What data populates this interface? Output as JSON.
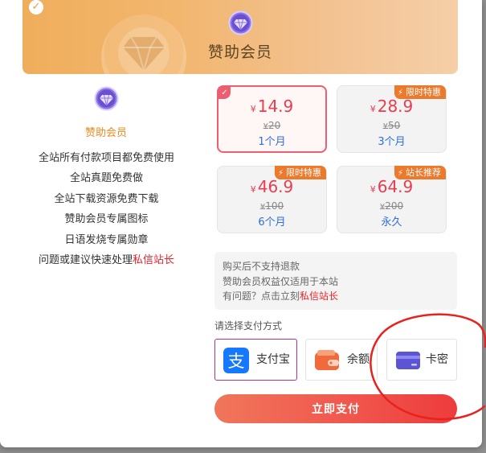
{
  "banner": {
    "title": "赞助会员"
  },
  "left": {
    "title": "赞助会员",
    "perks": [
      "全站所有付款项目都免费使用",
      "全站真题免费做",
      "全站下载资源免费下载",
      "赞助会员专属图标",
      "日语发烧专属勋章"
    ],
    "last_perk_prefix": "问题或建议快速处理",
    "last_perk_link": "私信站长"
  },
  "currency": "¥",
  "plans": [
    {
      "price": "14.9",
      "orig": "20",
      "duration": "1个月",
      "tag": "",
      "selected": true
    },
    {
      "price": "28.9",
      "orig": "50",
      "duration": "3个月",
      "tag": "限时特惠",
      "selected": false
    },
    {
      "price": "46.9",
      "orig": "100",
      "duration": "6个月",
      "tag": "限时特惠",
      "selected": false
    },
    {
      "price": "64.9",
      "orig": "200",
      "duration": "永久",
      "tag": "站长推荐",
      "selected": false
    }
  ],
  "notice": {
    "line1": "购买后不支持退款",
    "line2": "赞助会员权益仅适用于本站",
    "line3_prefix": "有问题？点击立刻",
    "line3_link": "私信站长"
  },
  "payment": {
    "label": "请选择支付方式",
    "methods": [
      {
        "label": "支付宝",
        "icon": "alipay-icon",
        "selected": true
      },
      {
        "label": "余额",
        "icon": "wallet-icon",
        "selected": false
      },
      {
        "label": "卡密",
        "icon": "card-icon",
        "selected": false
      }
    ]
  },
  "submit_label": "立即支付",
  "colors": {
    "price_red": "#ea3c4e",
    "duration_blue": "#2d6fd8",
    "tag_orange": "#ec7a2c",
    "alipay_blue": "#1677ff",
    "annotation_red": "#e8231d"
  }
}
